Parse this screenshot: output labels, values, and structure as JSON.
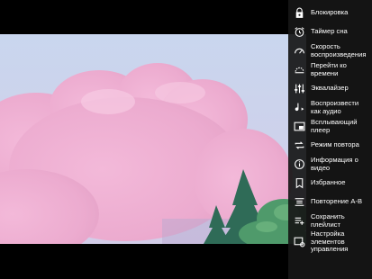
{
  "menu": {
    "items": [
      {
        "label": "Блокировка",
        "icon": "lock-icon"
      },
      {
        "label": "Таймер сна",
        "icon": "alarm-timer-icon"
      },
      {
        "label": "Скорость воспроизведения",
        "icon": "speedometer-icon"
      },
      {
        "label": "Перейти ко времени",
        "icon": "jump-to-time-icon"
      },
      {
        "label": "Эквалайзер",
        "icon": "equalizer-icon"
      },
      {
        "label": "Воспроизвести как аудио",
        "icon": "audio-note-icon"
      },
      {
        "label": "Всплывающий плеер",
        "icon": "popup-player-icon"
      },
      {
        "label": "Режим повтора",
        "icon": "repeat-icon"
      },
      {
        "label": "Информация о видео",
        "icon": "info-icon"
      },
      {
        "label": "Избранное",
        "icon": "bookmark-icon"
      },
      {
        "label": "Повторение A-B",
        "icon": "ab-repeat-icon"
      },
      {
        "label": "Сохранить плейлист",
        "icon": "save-playlist-icon"
      },
      {
        "label": "Настройка элементов управления",
        "icon": "customize-controls-icon"
      }
    ]
  }
}
